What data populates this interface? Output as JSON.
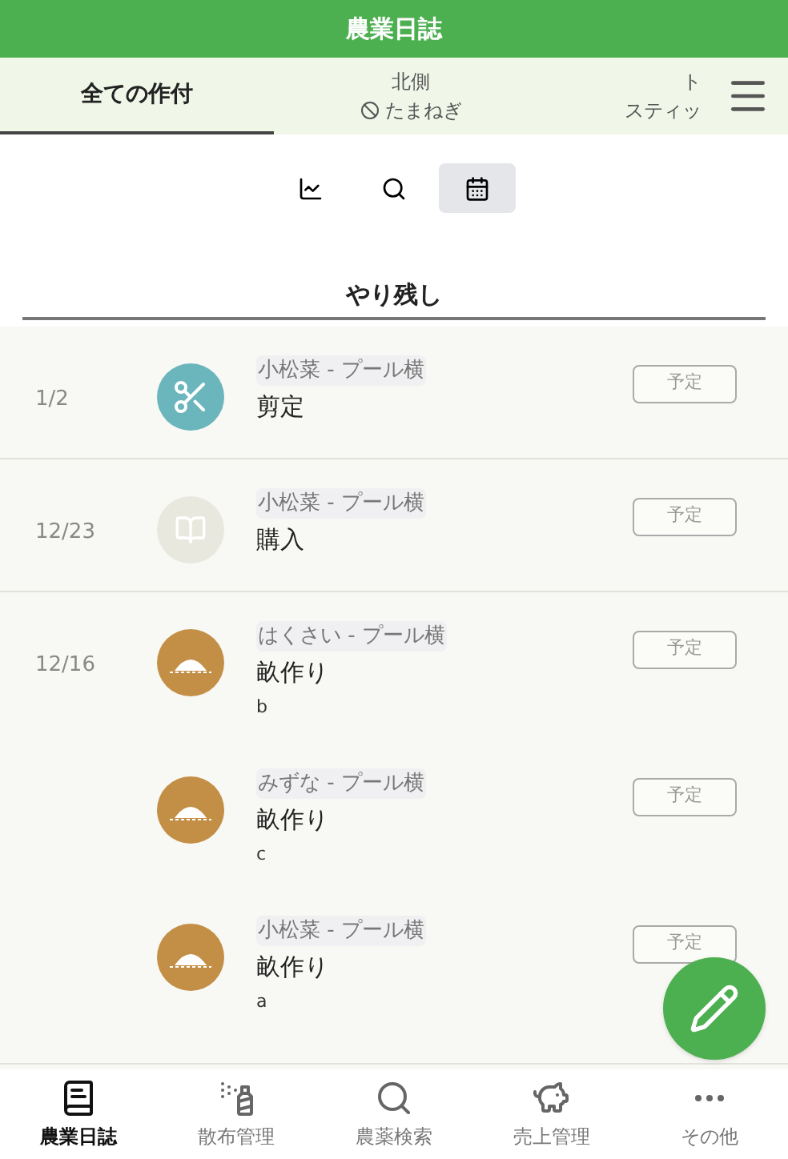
{
  "header": {
    "title": "農業日誌"
  },
  "tabs": [
    {
      "label": "全ての作付",
      "selected": true
    },
    {
      "area": "北側",
      "label": "たまねぎ",
      "disabled": true,
      "selected": false
    },
    {
      "area": "ト",
      "label": "スティッ",
      "selected": false
    }
  ],
  "view_toggles": [
    {
      "kind": "chart",
      "selected": false
    },
    {
      "kind": "search",
      "selected": false
    },
    {
      "kind": "calendar",
      "selected": true
    }
  ],
  "section_title": "やり残し",
  "groups": [
    {
      "date": "1/2",
      "items": [
        {
          "kind": "prune",
          "crop": "小松菜 - プール横",
          "task": "剪定",
          "status": "予定"
        }
      ]
    },
    {
      "date": "12/23",
      "items": [
        {
          "kind": "purchase",
          "crop": "小松菜 - プール横",
          "task": "購入",
          "status": "予定"
        }
      ]
    },
    {
      "date": "12/16",
      "items": [
        {
          "kind": "ridge",
          "crop": "はくさい - プール横",
          "task": "畝作り",
          "note": "b",
          "status": "予定"
        },
        {
          "kind": "ridge",
          "crop": "みずな - プール横",
          "task": "畝作り",
          "note": "c",
          "status": "予定"
        },
        {
          "kind": "ridge",
          "crop": "小松菜 - プール横",
          "task": "畝作り",
          "note": "a",
          "status": "予定"
        }
      ]
    }
  ],
  "bottom_nav": [
    {
      "kind": "diary",
      "label": "農業日誌",
      "selected": true
    },
    {
      "kind": "spray",
      "label": "散布管理",
      "selected": false
    },
    {
      "kind": "search",
      "label": "農薬検索",
      "selected": false
    },
    {
      "kind": "sales",
      "label": "売上管理",
      "selected": false
    },
    {
      "kind": "more",
      "label": "その他",
      "selected": false
    }
  ]
}
